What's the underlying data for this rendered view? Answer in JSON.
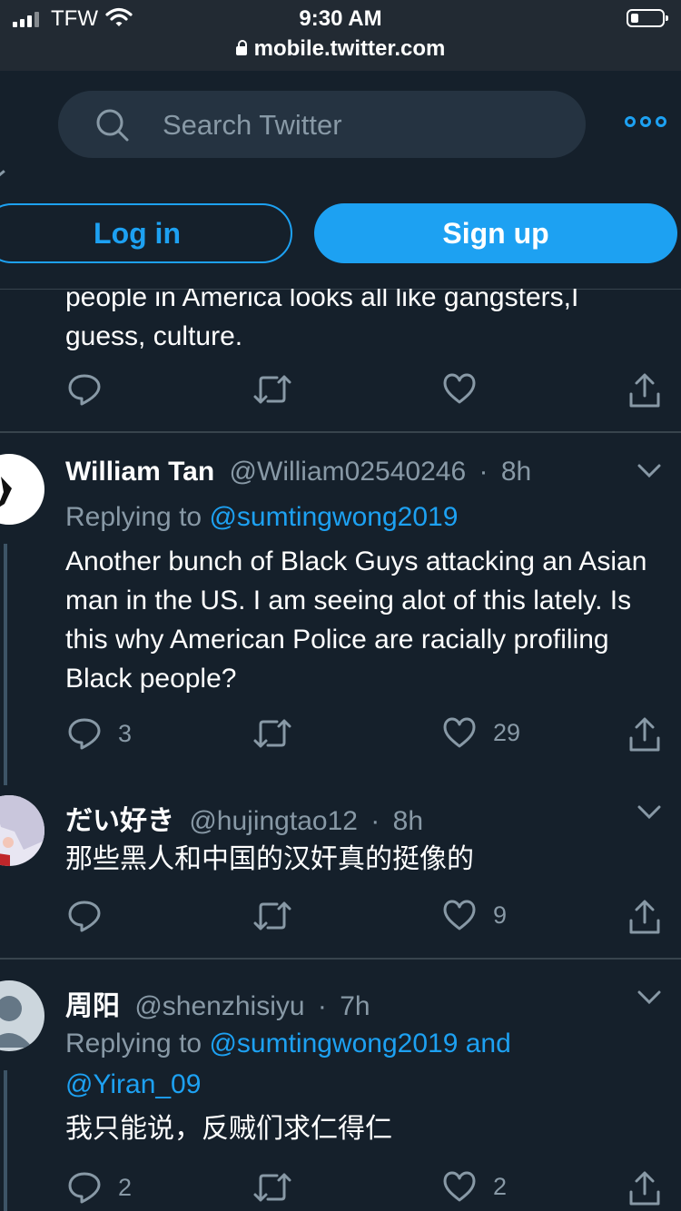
{
  "status_bar": {
    "carrier": "TFW",
    "time": "9:30 AM",
    "url": "mobile.twitter.com"
  },
  "header": {
    "search_placeholder": "Search Twitter",
    "login_label": "Log in",
    "signup_label": "Sign up"
  },
  "partial_tweet": {
    "text": "people in America looks all like gangsters,I guess, culture."
  },
  "tweets": [
    {
      "name": "William Tan",
      "handle": "@William02540246",
      "separator": "·",
      "time": "8h",
      "reply_prefix": "Replying to",
      "reply_mentions": "@sumtingwong2019",
      "text": "Another bunch of Black Guys attacking an Asian man in the US. I am seeing alot of this lately. Is this why American Police are racially profiling Black people?",
      "replies": "3",
      "retweets": "",
      "likes": "29"
    },
    {
      "name": "だい好き",
      "handle": "@hujingtao12",
      "separator": "·",
      "time": "8h",
      "text": "那些黑人和中国的汉奸真的挺像的",
      "replies": "",
      "retweets": "",
      "likes": "9"
    },
    {
      "name": "周阳",
      "handle": "@shenzhisiyu",
      "separator": "·",
      "time": "7h",
      "reply_prefix": "Replying to",
      "reply_mentions": "@sumtingwong2019 and @Yiran_09",
      "text": "我只能说，反贼们求仁得仁",
      "replies": "2",
      "retweets": "",
      "likes": "2"
    }
  ],
  "colors": {
    "background": "#15202b",
    "accent": "#1da1f2",
    "muted": "#8899a6",
    "divider": "#38444d"
  }
}
